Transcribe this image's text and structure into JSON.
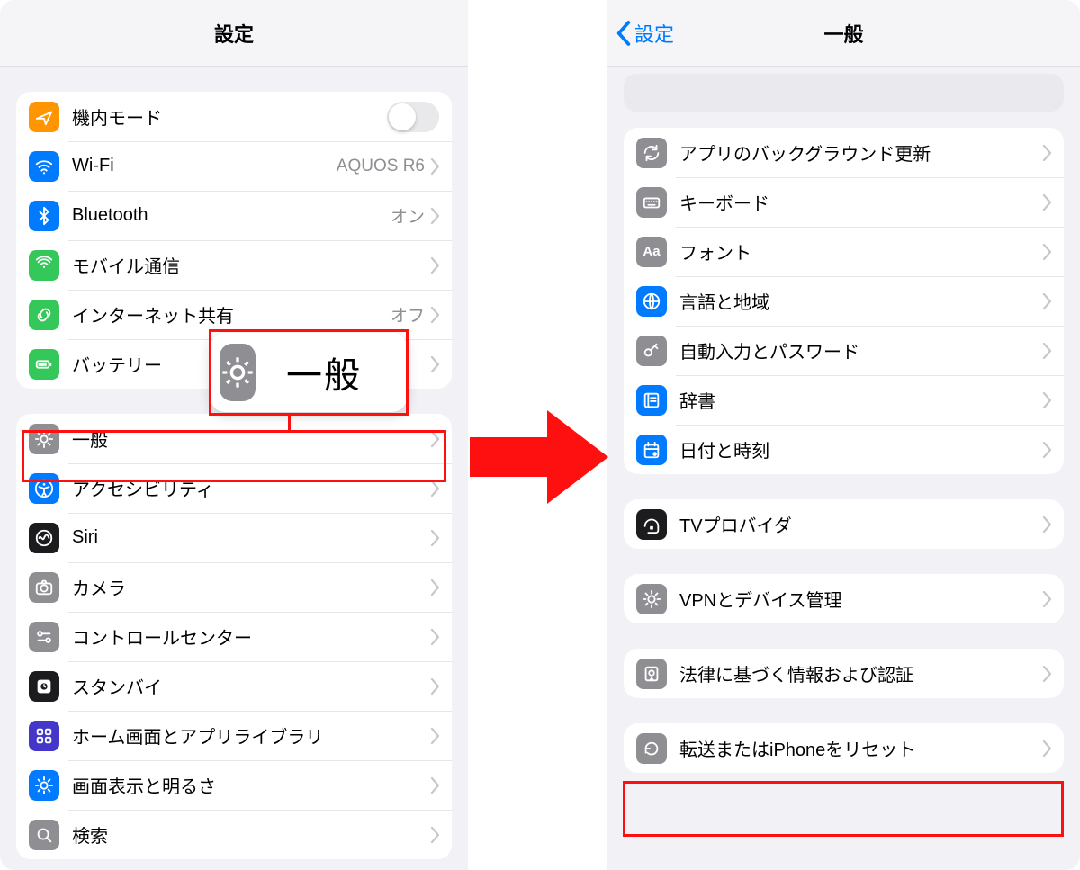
{
  "left": {
    "title": "設定",
    "group1": [
      {
        "name": "row-airplane",
        "label": "機内モード",
        "value": "",
        "control": "switch",
        "icon": "airplane",
        "bg": "#ff9500"
      },
      {
        "name": "row-wifi",
        "label": "Wi-Fi",
        "value": "AQUOS R6",
        "control": "chevron",
        "icon": "wifi",
        "bg": "#007aff"
      },
      {
        "name": "row-bluetooth",
        "label": "Bluetooth",
        "value": "オン",
        "control": "chevron",
        "icon": "bluetooth",
        "bg": "#007aff"
      },
      {
        "name": "row-cellular",
        "label": "モバイル通信",
        "value": "",
        "control": "chevron",
        "icon": "antenna",
        "bg": "#34c759"
      },
      {
        "name": "row-hotspot",
        "label": "インターネット共有",
        "value": "オフ",
        "control": "chevron",
        "icon": "link",
        "bg": "#34c759"
      },
      {
        "name": "row-battery",
        "label": "バッテリー",
        "value": "",
        "control": "chevron",
        "icon": "battery",
        "bg": "#34c759"
      }
    ],
    "group2": [
      {
        "name": "row-general",
        "label": "一般",
        "icon": "gear",
        "bg": "#8e8e93"
      },
      {
        "name": "row-accessibility",
        "label": "アクセシビリティ",
        "icon": "access",
        "bg": "#007aff"
      },
      {
        "name": "row-siri",
        "label": "Siri",
        "icon": "siri",
        "bg": "#1c1c1e"
      },
      {
        "name": "row-camera",
        "label": "カメラ",
        "icon": "camera",
        "bg": "#8e8e93"
      },
      {
        "name": "row-controlcenter",
        "label": "コントロールセンター",
        "icon": "switches",
        "bg": "#8e8e93"
      },
      {
        "name": "row-standby",
        "label": "スタンバイ",
        "icon": "standby",
        "bg": "#1c1c1e"
      },
      {
        "name": "row-home",
        "label": "ホーム画面とアプリライブラリ",
        "icon": "grid",
        "bg": "#4336c9"
      },
      {
        "name": "row-display",
        "label": "画面表示と明るさ",
        "icon": "sun",
        "bg": "#007aff"
      },
      {
        "name": "row-search",
        "label": "検索",
        "icon": "search",
        "bg": "#8e8e93"
      }
    ],
    "callout": {
      "label": "一般",
      "icon": "gear",
      "bg": "#8e8e93"
    }
  },
  "right": {
    "back": "設定",
    "title": "一般",
    "groupA": [
      {
        "name": "row-bgrefresh",
        "label": "アプリのバックグラウンド更新",
        "icon": "refresh",
        "bg": "#8e8e93"
      },
      {
        "name": "row-keyboard",
        "label": "キーボード",
        "icon": "keyboard",
        "bg": "#8e8e93"
      },
      {
        "name": "row-fonts",
        "label": "フォント",
        "icon": "fonts",
        "bg": "#8e8e93",
        "text": "Aa"
      },
      {
        "name": "row-lang",
        "label": "言語と地域",
        "icon": "globe",
        "bg": "#007aff"
      },
      {
        "name": "row-autofill",
        "label": "自動入力とパスワード",
        "icon": "key",
        "bg": "#8e8e93"
      },
      {
        "name": "row-dict",
        "label": "辞書",
        "icon": "book",
        "bg": "#007aff"
      },
      {
        "name": "row-datetime",
        "label": "日付と時刻",
        "icon": "calendar",
        "bg": "#007aff"
      }
    ],
    "groupB": [
      {
        "name": "row-tvprovider",
        "label": "TVプロバイダ",
        "icon": "tv",
        "bg": "#1c1c1e"
      }
    ],
    "groupC": [
      {
        "name": "row-vpn",
        "label": "VPNとデバイス管理",
        "icon": "gear",
        "bg": "#8e8e93"
      }
    ],
    "groupD": [
      {
        "name": "row-legal",
        "label": "法律に基づく情報および認証",
        "icon": "cert",
        "bg": "#8e8e93"
      }
    ],
    "groupE": [
      {
        "name": "row-reset",
        "label": "転送またはiPhoneをリセット",
        "icon": "reset",
        "bg": "#8e8e93"
      }
    ]
  }
}
